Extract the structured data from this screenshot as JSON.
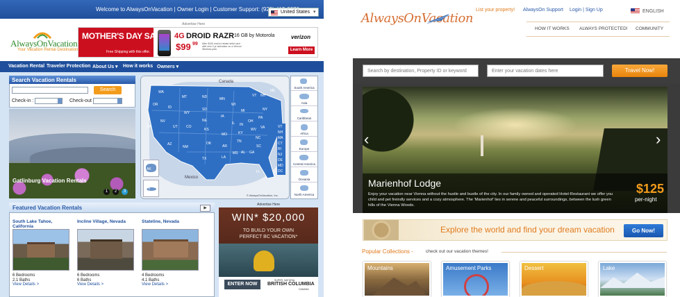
{
  "left": {
    "topbar": {
      "welcome": "Welcome to AlwaysOnVacation",
      "owner_login": "Owner Login",
      "support": "Customer Support: (925) 415-2370",
      "country": "United States"
    },
    "logo": {
      "text": "AlwaysOnVacation.com",
      "tagline": "Your Vacation Rental Destination"
    },
    "ad_top": {
      "label": "Advertise Here",
      "sale": "MOTHER'S DAY SALE",
      "shipping": "Free Shipping with this offer.",
      "phone": "DROID RAZR",
      "brand": "4G",
      "capacity": "16 GB by Motorola",
      "price": "$99",
      "cents": "99",
      "fine": "After $100 mail-in rebate debit card with new 2-yr activation on a Verizon Wireless plan",
      "carrier": "verizon",
      "cta": "Learn More"
    },
    "nav": [
      "Vacation Rental",
      "Traveler Protection",
      "About Us ▾",
      "How it works",
      "Owners ▾"
    ],
    "search": {
      "title": "Search Vacation Rentals",
      "button": "Search",
      "checkin": "Check-in :",
      "checkout": "Check-out :"
    },
    "hero": {
      "caption": "Gatlinburg Vacation Rentals",
      "dots": [
        "1",
        "2",
        "3"
      ]
    },
    "map": {
      "canada": "Canada",
      "mexico": "Mexico",
      "copyright": "© AlwaysOnVacation, Inc.",
      "states": [
        "WA",
        "OR",
        "ID",
        "MT",
        "WY",
        "ND",
        "SD",
        "NE",
        "MN",
        "WI",
        "MI",
        "NY",
        "VT",
        "NH",
        "ME",
        "CA",
        "NV",
        "UT",
        "CO",
        "KS",
        "IA",
        "IL",
        "IN",
        "OH",
        "PA",
        "WV",
        "VA",
        "KY",
        "AZ",
        "NM",
        "OK",
        "MO",
        "TN",
        "NC",
        "SC",
        "AR",
        "MS",
        "AL",
        "GA",
        "TX",
        "LA",
        "FL",
        "AK",
        "HI",
        "MA",
        "CT",
        "RI",
        "NJ",
        "DE",
        "MD",
        "DC"
      ],
      "regions": [
        "South America",
        "Asia",
        "Caribbean",
        "Africa",
        "Europe",
        "Central America",
        "Oceania",
        "North America"
      ]
    },
    "featured": {
      "title": "Featured Vacation Rentals",
      "items": [
        {
          "name": "South Lake Tahoe, California",
          "beds": "6 Bedrooms",
          "baths": "2.1 Baths",
          "link": "View Details >"
        },
        {
          "name": "Incline Village, Nevada",
          "beds": "6 Bedrooms",
          "baths": "6 Baths",
          "link": "View Details >"
        },
        {
          "name": "Stateline, Nevada",
          "beds": "4 Bedrooms",
          "baths": "4.1 Baths",
          "link": "View Details >"
        }
      ]
    },
    "ad_side": {
      "label": "Advertise Here",
      "win": "WIN* $20,000",
      "line1": "TO BUILD YOUR OWN",
      "line2": "PERFECT BC VACATION*",
      "enter": "ENTER NOW",
      "bc_top": "SUPER, NATURAL",
      "bc": "BRITISH COLUMBIA",
      "bc_sub": "CANADA"
    }
  },
  "right": {
    "logo": "AlwaysOnVacation",
    "top_links": {
      "list": "List your property!",
      "support": "AlwaysOn Support",
      "login": "Login | Sign Up",
      "lang": "ENGLISH"
    },
    "nav": [
      "HOW IT WORKS",
      "ALWAYS PROTECTED!",
      "COMMUNITY"
    ],
    "search": {
      "placeholder1": "Search by destination, Property ID or keyword",
      "placeholder2": "Enter your vacation dates here",
      "button": "Travel Now!"
    },
    "hero": {
      "title": "Marienhof Lodge",
      "desc": "Enjoy your vacation near Vienna without the hustle and bustle of the city. In our family owned and operated Hotel-Restaurant we offer you child and pet freindly services and a cozy atmosphere. The 'Marienhof' lies in serene and peaceful surroundings, between the lush green hills of the Vienna Woods.",
      "price": "$125",
      "per": "per-night"
    },
    "explore": {
      "text": "Explore the world and find your dream vacation",
      "button": "Go Now!"
    },
    "collections": {
      "title": "Popular Collections -",
      "sub": "check out our vacation themes!",
      "items": [
        "Mountains",
        "Amusement Parks",
        "Dessert",
        "Lake"
      ]
    }
  },
  "colors": {
    "blue": "#2a5aa8",
    "orange": "#f39c1c",
    "lightblue": "#cfe0f3"
  }
}
